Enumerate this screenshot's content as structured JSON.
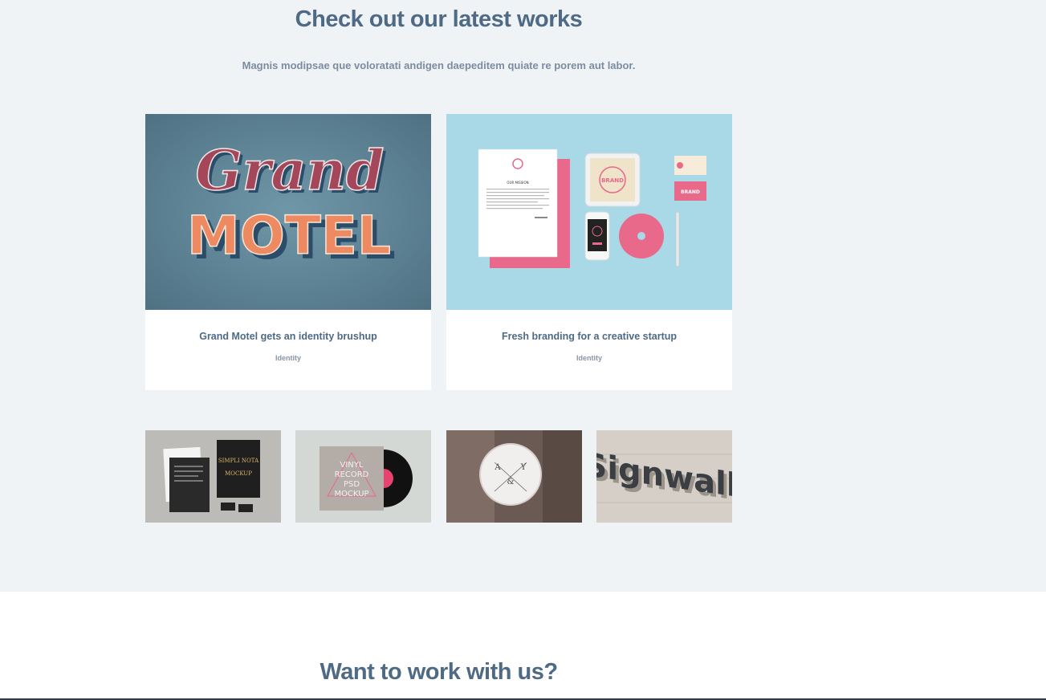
{
  "works": {
    "title": "Check out our latest works",
    "subtitle": "Magnis modipsae que voloratati andigen daepeditem quiate re porem aut labor.",
    "featured": [
      {
        "title": "Grand Motel gets an identity brushup",
        "category": "Identity",
        "image": {
          "script_text": "Grand",
          "block_text": "MOTEL"
        }
      },
      {
        "title": "Fresh branding for a creative startup",
        "category": "Identity",
        "image": {
          "letter_heading": "OUR MISSION",
          "brand_text": "BRAND",
          "card_brand_text": "BRAND"
        }
      }
    ],
    "thumbnails": [
      {
        "name": "stationery-mockup",
        "text": [
          "SIMPLI NOTA",
          "MOCKUP"
        ]
      },
      {
        "name": "vinyl-record-mockup",
        "text": [
          "VINYL",
          "RECORD",
          "PSD",
          "MOCKUP"
        ]
      },
      {
        "name": "window-sign-mockup",
        "text": [
          "A",
          "Y",
          "&"
        ]
      },
      {
        "name": "signwall-mockup",
        "text": [
          "Signwall"
        ]
      }
    ]
  },
  "cta": {
    "title": "Want to work with us?"
  },
  "colors": {
    "section_bg": "#eff3f6",
    "heading": "#4e6a85",
    "muted": "#7c8ca0",
    "accent_pink": "#e85a7a"
  }
}
